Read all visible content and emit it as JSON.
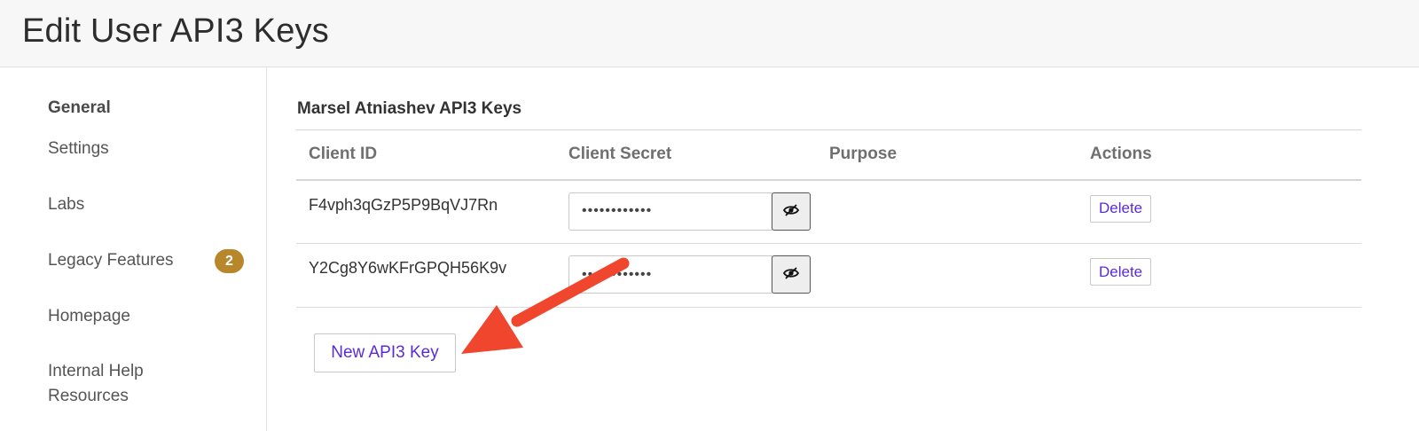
{
  "page": {
    "title": "Edit User API3 Keys"
  },
  "sidebar": {
    "heading": "General",
    "items": [
      {
        "label": "Settings"
      },
      {
        "label": "Labs"
      },
      {
        "label": "Legacy Features",
        "badge": "2"
      },
      {
        "label": "Homepage"
      },
      {
        "label": "Internal Help Resources"
      }
    ]
  },
  "main": {
    "section_title": "Marsel Atniashev API3 Keys",
    "columns": [
      "Client ID",
      "Client Secret",
      "Purpose",
      "Actions"
    ],
    "rows": [
      {
        "client_id": "F4vph3qGzP5P9BqVJ7Rn",
        "secret_masked": "••••••••••••",
        "purpose": "",
        "action": "Delete"
      },
      {
        "client_id": "Y2Cg8Y6wKFrGPQH56K9v",
        "secret_masked": "••••••••••••",
        "purpose": "",
        "action": "Delete"
      }
    ],
    "new_key_label": "New API3 Key"
  },
  "icons": {
    "reveal": "eye-slash-icon",
    "annotation": "red-arrow-icon"
  },
  "colors": {
    "accent": "#5a2bd6",
    "badge": "#b8862b",
    "annotation_arrow": "#f0462d"
  }
}
